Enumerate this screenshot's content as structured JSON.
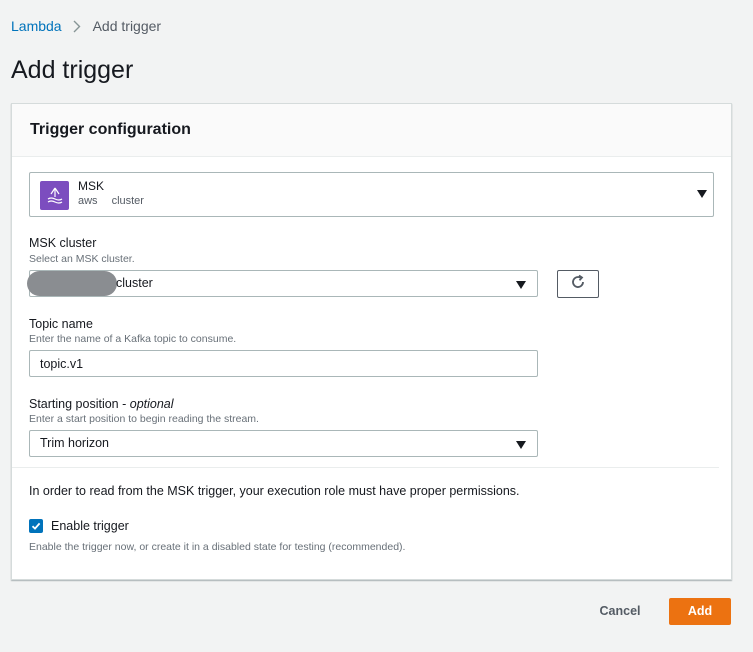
{
  "breadcrumb": {
    "parent": "Lambda",
    "current": "Add trigger"
  },
  "page": {
    "title": "Add trigger"
  },
  "panel": {
    "header": "Trigger configuration"
  },
  "source": {
    "name": "MSK",
    "tags": [
      "aws",
      "cluster"
    ],
    "logo_color": "#7c4dbf"
  },
  "msk_cluster": {
    "label": "MSK cluster",
    "description": "Select an MSK cluster.",
    "value": "cluster"
  },
  "topic": {
    "label": "Topic name",
    "description": "Enter the name of a Kafka topic to consume.",
    "value": "topic.v1"
  },
  "starting_position": {
    "label": "Starting position - ",
    "optional": "optional",
    "description": "Enter a start position to begin reading the stream.",
    "value": "Trim horizon"
  },
  "permissions_note": "In order to read from the MSK trigger, your execution role must have proper permissions.",
  "enable_trigger": {
    "label": "Enable trigger",
    "checked": true,
    "description": "Enable the trigger now, or create it in a disabled state for testing (recommended)."
  },
  "actions": {
    "cancel": "Cancel",
    "add": "Add"
  },
  "colors": {
    "primary": "#ec7211",
    "link": "#0073bb",
    "checkbox": "#0073bb"
  }
}
